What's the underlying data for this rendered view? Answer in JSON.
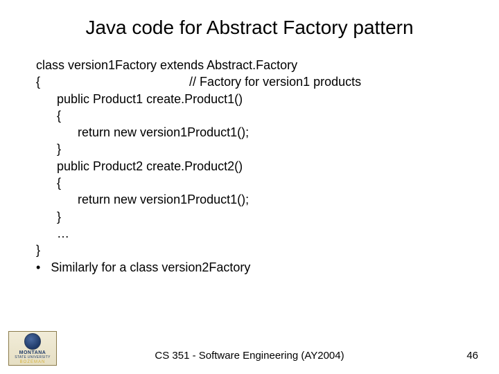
{
  "title": "Java code for Abstract Factory pattern",
  "code": {
    "l1": "class version1Factory extends Abstract.Factory",
    "l2": "{                                           // Factory for version1 products",
    "l3": "      public Product1 create.Product1()",
    "l4": "      {",
    "l5": "            return new version1Product1();",
    "l6": "      }",
    "l7": "      public Product2 create.Product2()",
    "l8": "      {",
    "l9": "            return new version1Product1();",
    "l10": "      }",
    "l11": "      …",
    "l12": "}",
    "bullet_char": "•",
    "bullet_text": "   Similarly for a class version2Factory"
  },
  "footer": {
    "center": "CS 351 - Software Engineering (AY2004)",
    "page": "46"
  },
  "logo": {
    "line1": "MONTANA",
    "line2": "STATE UNIVERSITY",
    "line3": "BOZEMAN"
  }
}
